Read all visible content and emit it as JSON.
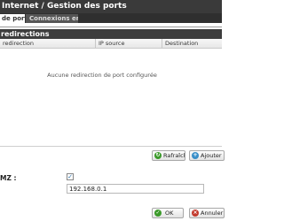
{
  "window": {
    "title": "Internet / Gestion des ports"
  },
  "tabs": [
    {
      "label": "de ports",
      "active": true
    },
    {
      "label": "Connexions entrantes",
      "active": false
    }
  ],
  "section": {
    "title": "redirections"
  },
  "table": {
    "columns": [
      "redirection",
      "IP source",
      "Destination"
    ],
    "empty_message": "Aucune redirection de port configurée"
  },
  "actions": {
    "refresh_label": "Rafraîchir",
    "add_label": "Ajouter u"
  },
  "dmz": {
    "label": "MZ :",
    "enabled": true,
    "ip_value": "192.168.0.1"
  },
  "footer": {
    "ok_label": "OK",
    "cancel_label": "Annuler"
  }
}
